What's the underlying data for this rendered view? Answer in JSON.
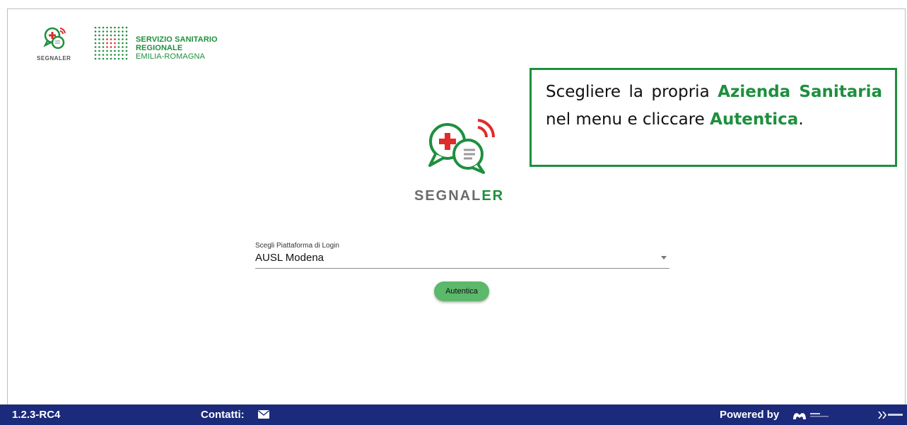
{
  "header": {
    "small_logo_text": "SEGNALER",
    "ssr_line1": "SERVIZIO SANITARIO REGIONALE",
    "ssr_line2": "EMILIA-ROMAGNA"
  },
  "callout": {
    "part1": "Scegliere la propria ",
    "highlight1": "Azienda Sanitaria",
    "part2": " nel menu e cliccare ",
    "highlight2": "Autentica",
    "part3": "."
  },
  "brand": {
    "name_main": "SEGNAL",
    "name_accent": "ER"
  },
  "login": {
    "select_label": "Scegli Piattaforma di Login",
    "select_value": "AUSL Modena",
    "button_label": "Autentica"
  },
  "footer": {
    "version": "1.2.3-RC4",
    "contacts_label": "Contatti:",
    "powered_by": "Powered by"
  },
  "colors": {
    "accent_green": "#1e8f3e",
    "footer_bg": "#1b2a7a",
    "button_green": "#5cb86a",
    "logo_red": "#e02b2b"
  }
}
